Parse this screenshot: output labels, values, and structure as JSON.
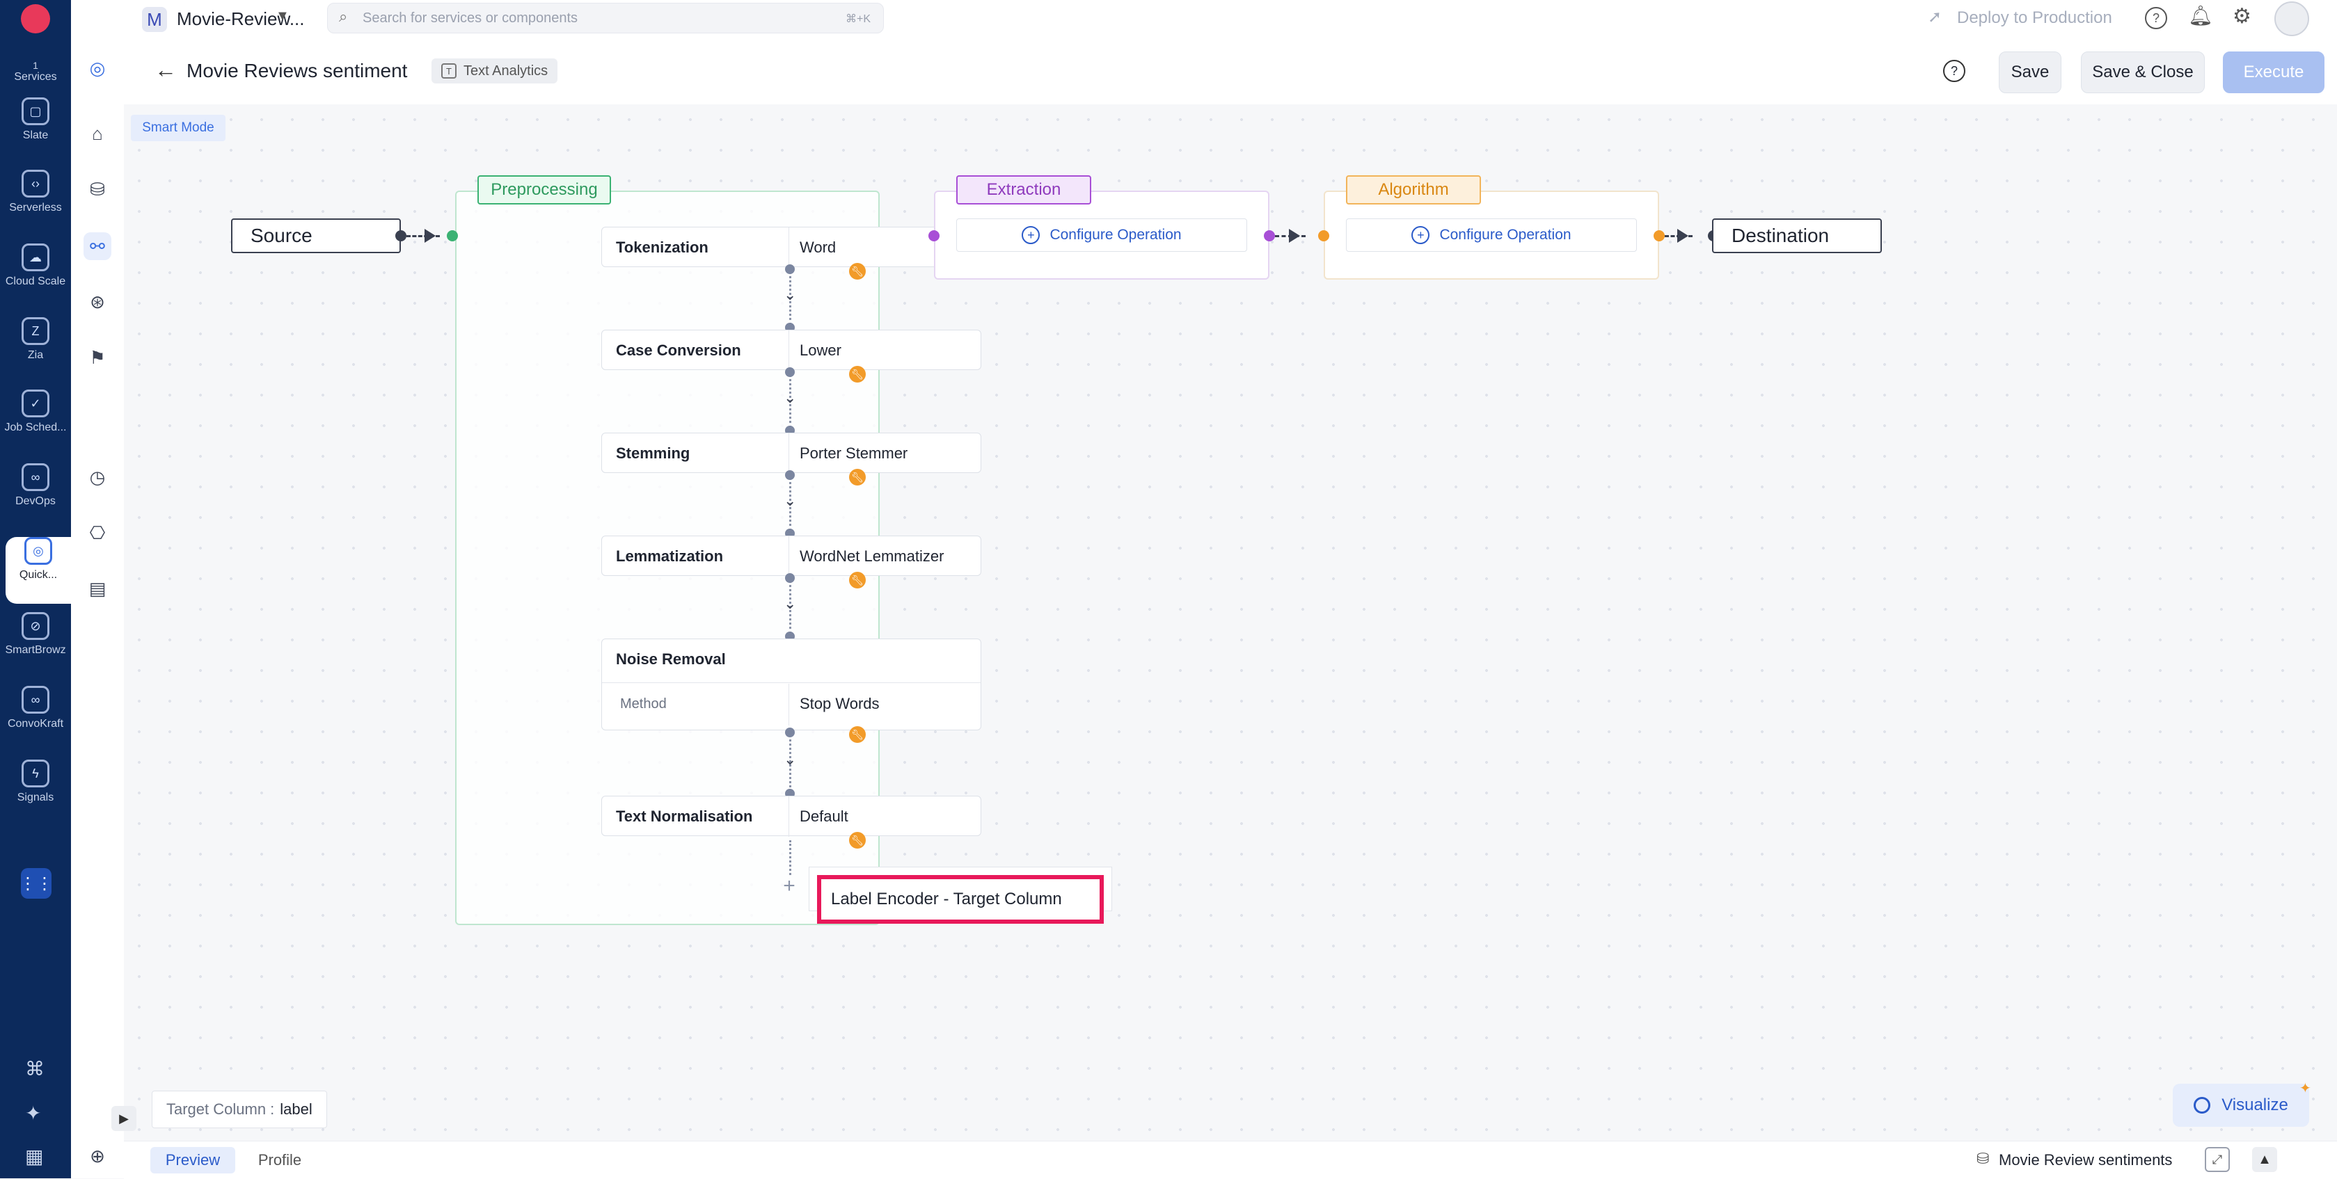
{
  "left_rail": {
    "services_count": "1",
    "services_label": "Services",
    "items": [
      {
        "label": "Slate",
        "icon": "slate-icon",
        "glyph": "▢"
      },
      {
        "label": "Serverless",
        "icon": "serverless-icon",
        "glyph": "‹›"
      },
      {
        "label": "Cloud Scale",
        "icon": "cloud-scale-icon",
        "glyph": "☁"
      },
      {
        "label": "Zia",
        "icon": "zia-icon",
        "glyph": "Z"
      },
      {
        "label": "Job Sched...",
        "icon": "job-scheduling-icon",
        "glyph": "✓"
      },
      {
        "label": "DevOps",
        "icon": "devops-icon",
        "glyph": "∞"
      },
      {
        "label": "Quick...",
        "icon": "quickml-icon",
        "glyph": "◎"
      },
      {
        "label": "SmartBrowz",
        "icon": "smartbrowz-icon",
        "glyph": "⊘"
      },
      {
        "label": "ConvoKraft",
        "icon": "convokraft-icon",
        "glyph": "∞"
      },
      {
        "label": "Signals",
        "icon": "signals-icon",
        "glyph": "ϟ"
      }
    ]
  },
  "topbar": {
    "project_initial": "M",
    "project_name": "Movie-Review...",
    "search_placeholder": "Search for services or components",
    "search_shortcut": "⌘+K",
    "deploy_label": "Deploy to Production"
  },
  "header": {
    "title": "Movie Reviews sentiment",
    "type_badge": "Text Analytics",
    "save": "Save",
    "save_close": "Save & Close",
    "execute": "Execute"
  },
  "canvas": {
    "smart_mode": "Smart Mode",
    "source": "Source",
    "destination": "Destination",
    "preprocessing_label": "Preprocessing",
    "extraction_label": "Extraction",
    "algorithm_label": "Algorithm",
    "configure_operation": "Configure Operation",
    "operations": [
      {
        "name": "Tokenization",
        "value": "Word"
      },
      {
        "name": "Case Conversion",
        "value": "Lower"
      },
      {
        "name": "Stemming",
        "value": "Porter Stemmer"
      },
      {
        "name": "Lemmatization",
        "value": "WordNet Lemmatizer"
      },
      {
        "name": "Noise Removal",
        "sub_label": "Method",
        "value": "Stop Words"
      },
      {
        "name": "Text Normalisation",
        "value": "Default"
      }
    ],
    "suggestion": "Label Encoder - Target Column",
    "target_column_label": "Target Column :",
    "target_column_value": "label",
    "visualize": "Visualize"
  },
  "bottom": {
    "tabs": [
      "Preview",
      "Profile"
    ],
    "dataset": "Movie Review sentiments"
  },
  "colors": {
    "accent": "#3a6fe0",
    "preprocessing": "#3bb273",
    "extraction": "#a84fd6",
    "algorithm": "#f29b29",
    "highlight": "#e8195a"
  }
}
